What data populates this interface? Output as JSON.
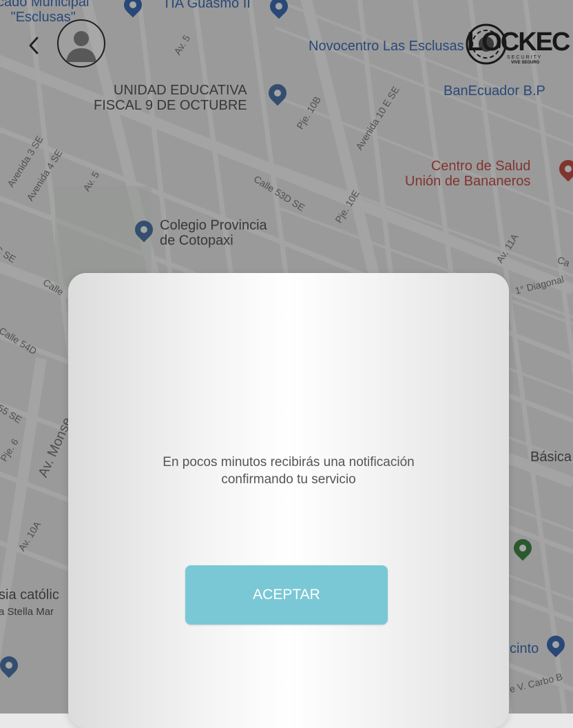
{
  "map": {
    "pois": {
      "mercado": "cado Municipal\n\"Esclusas\"",
      "tia": "TIA Guasmo II",
      "novocentro": "Novocentro Las Esclusas",
      "unidad_educativa": "UNIDAD EDUCATIVA\nFISCAL 9 DE OCTUBRE",
      "banecuador": "BanEcuador B.P",
      "centro_salud": "Centro de Salud\nUnión de Bananeros",
      "colegio": "Colegio Provincia\nde Cotopaxi",
      "basica": "Básica",
      "iglesia": "sia católic",
      "iglesia_sub": "a Stella Mar",
      "cinto": "cinto"
    },
    "streets": {
      "av5_a": "Av. 5",
      "av5_b": "Av. 5",
      "avenida_3se": "Avenida 3 SE",
      "avenida_4se": "Avenida 4 SE",
      "pje_10b": "Pje. 10B",
      "avenida_10e": "Avenida 10 E SE",
      "calle_53d": "Calle 53D SE",
      "pje_10e": "Pje. 10E",
      "av_11a": "Av. 11A",
      "diagonal": "1° Diagonal",
      "calle_54d": "Calle 54D",
      "calle_55": "55 SE",
      "pje_6": "Pje. 6",
      "av_monse": "Av. Monse",
      "av_10a": "Av. 10A",
      "carbo": "e V. Carbo B",
      "calle_left": "Calle",
      "cse": "C SE",
      "ca": "Ca"
    }
  },
  "header": {
    "back_icon": "chevron-left-icon",
    "avatar_icon": "user-avatar-icon"
  },
  "logo": {
    "text": "LOCKEC",
    "sub1": "SECURITY",
    "sub2": "VIVE SEGURO"
  },
  "modal": {
    "message": "En pocos minutos recibirás una notificación\nconfirmando tu servicio",
    "accept_label": "ACEPTAR"
  },
  "colors": {
    "accent": "#7ac8d6",
    "overlay": "rgba(40,40,40,0.42)",
    "poi_blue": "#2a5fb0",
    "poi_red": "#c23d32"
  }
}
